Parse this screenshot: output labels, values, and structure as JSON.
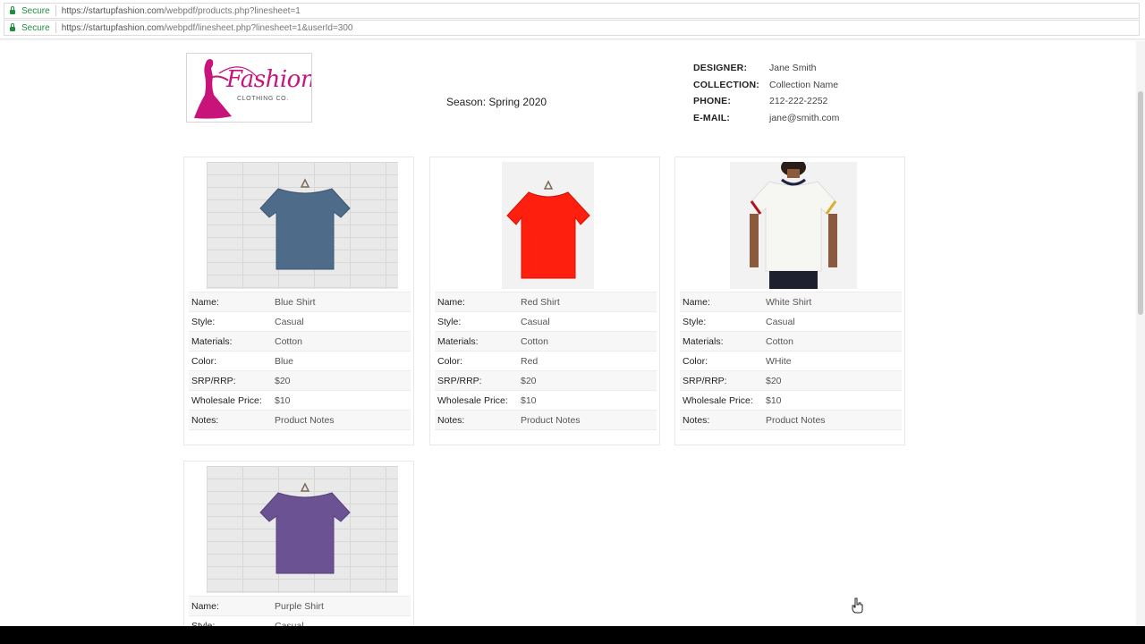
{
  "browser": {
    "bars": [
      {
        "secure_label": "Secure",
        "url_host": "https://startupfashion.com",
        "url_path": "/webpdf/products.php?linesheet=1"
      },
      {
        "secure_label": "Secure",
        "url_host": "https://startupfashion.com",
        "url_path": "/webpdf/linesheet.php?linesheet=1&userId=300"
      }
    ]
  },
  "logo": {
    "word": "Fashion",
    "subtitle": "CLOTHING CO."
  },
  "header": {
    "season": "Season: Spring 2020",
    "info": [
      {
        "label": "DESIGNER:",
        "value": "Jane Smith"
      },
      {
        "label": "COLLECTION:",
        "value": "Collection Name"
      },
      {
        "label": "PHONE:",
        "value": "212-222-2252"
      },
      {
        "label": "E-MAIL:",
        "value": "jane@smith.com"
      }
    ]
  },
  "field_labels": {
    "name": "Name:",
    "style": "Style:",
    "materials": "Materials:",
    "color": "Color:",
    "srp": "SRP/RRP:",
    "wholesale": "Wholesale Price:",
    "notes": "Notes:"
  },
  "products": [
    {
      "name": "Blue Shirt",
      "style": "Casual",
      "materials": "Cotton",
      "color": "Blue",
      "srp": "$20",
      "wholesale": "$10",
      "notes": "Product Notes",
      "shirt_color": "#4f6b8a"
    },
    {
      "name": "Red Shirt",
      "style": "Casual",
      "materials": "Cotton",
      "color": "Red",
      "srp": "$20",
      "wholesale": "$10",
      "notes": "Product Notes",
      "shirt_color": "#ff1f0f"
    },
    {
      "name": "White Shirt",
      "style": "Casual",
      "materials": "Cotton",
      "color": "WHite",
      "srp": "$20",
      "wholesale": "$10",
      "notes": "Product Notes",
      "shirt_color": "#f6f6f2"
    },
    {
      "name": "Purple Shirt",
      "style": "Casual",
      "materials": "",
      "color": "",
      "srp": "",
      "wholesale": "",
      "notes": "",
      "shirt_color": "#6a5293"
    }
  ]
}
